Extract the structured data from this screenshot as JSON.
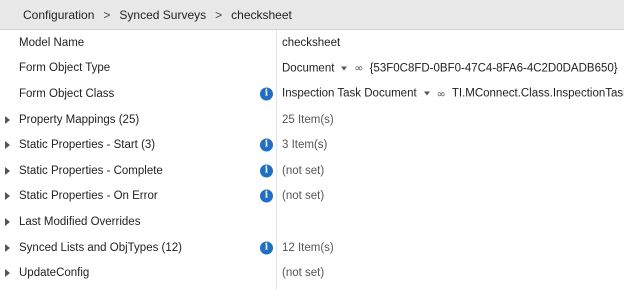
{
  "breadcrumb": {
    "items": [
      "Configuration",
      "Synced Surveys",
      "checksheet"
    ],
    "separator": ">"
  },
  "rows": [
    {
      "label": "Model Name",
      "value": "checksheet"
    },
    {
      "label": "Form Object Type",
      "value_type": "Document",
      "value_link": "{53F0C8FD-0BF0-47C4-8FA6-4C2D0DADB650}"
    },
    {
      "label": "Form Object Class",
      "value_type": "Inspection Task Document",
      "value_link": "TI.MConnect.Class.InspectionTask"
    },
    {
      "label": "Property Mappings (25)",
      "value": "25 Item(s)"
    },
    {
      "label": "Static Properties - Start (3)",
      "value": "3 Item(s)"
    },
    {
      "label": "Static Properties - Complete",
      "value": "(not set)"
    },
    {
      "label": "Static Properties - On Error",
      "value": "(not set)"
    },
    {
      "label": "Last Modified Overrides",
      "value": ""
    },
    {
      "label": "Synced Lists and ObjTypes (12)",
      "value": "12 Item(s)"
    },
    {
      "label": "UpdateConfig",
      "value": "(not set)"
    }
  ],
  "icons": {
    "info": "info-icon",
    "expander": "expand-arrow-icon",
    "dropdown": "chevron-down-icon",
    "link": "link-icon"
  },
  "colors": {
    "info_blue": "#1f6fc5",
    "header_bg": "#e8e8e8"
  }
}
